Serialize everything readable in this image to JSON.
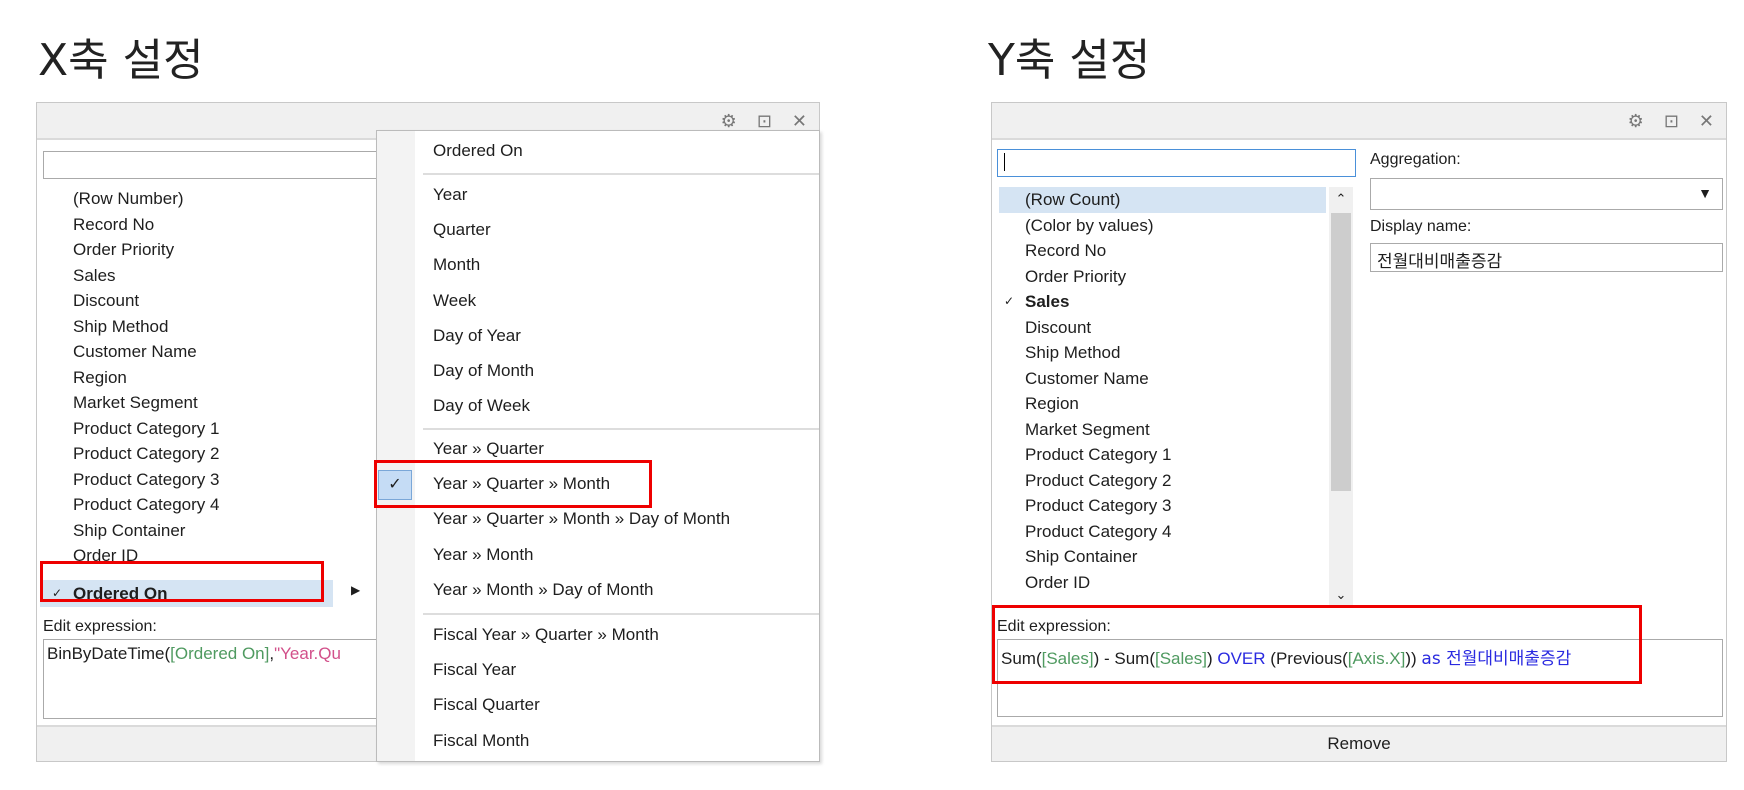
{
  "x_section": {
    "title": "X축 설정",
    "fields": [
      "(Row Number)",
      "Record No",
      "Order Priority",
      "Sales",
      "Discount",
      "Ship Method",
      "Customer Name",
      "Region",
      "Market Segment",
      "Product Category 1",
      "Product Category 2",
      "Product Category 3",
      "Product Category 4",
      "Ship Container",
      "Order ID",
      "Ordered On"
    ],
    "selected_field": "Ordered On",
    "edit_expression_label": "Edit expression:",
    "expression": {
      "fn": "BinByDateTime(",
      "col": "[Ordered On]",
      "sep": ",",
      "str": "\"Year.Qu"
    },
    "menu": {
      "header": "Ordered On",
      "group1": [
        "Year",
        "Quarter",
        "Month",
        "Week",
        "Day of Year",
        "Day of Month",
        "Day of Week"
      ],
      "group2": [
        "Year » Quarter",
        "Year » Quarter » Month",
        "Year » Quarter » Month » Day of Month",
        "Year » Month",
        "Year » Month » Day of Month"
      ],
      "group3": [
        "Fiscal Year » Quarter » Month",
        "Fiscal Year",
        "Fiscal Quarter",
        "Fiscal Month"
      ],
      "checked": "Year » Quarter » Month"
    }
  },
  "y_section": {
    "title": "Y축 설정",
    "search_value": "",
    "fields": [
      "(Row Count)",
      "(Color by values)",
      "Record No",
      "Order Priority",
      "Sales",
      "Discount",
      "Ship Method",
      "Customer Name",
      "Region",
      "Market Segment",
      "Product Category 1",
      "Product Category 2",
      "Product Category 3",
      "Product Category 4",
      "Ship Container",
      "Order ID"
    ],
    "checked_field": "Sales",
    "highlighted_field": "(Row Count)",
    "aggregation_label": "Aggregation:",
    "aggregation_value": "",
    "display_name_label": "Display name:",
    "display_name_value": "전월대비매출증감",
    "edit_expression_label": "Edit expression:",
    "expression": {
      "p1": "Sum(",
      "c1": "[Sales]",
      "p2": ") - Sum(",
      "c2": "[Sales]",
      "p3": ") ",
      "kw1": "OVER",
      "p4": " (Previous(",
      "c3": "[Axis.X]",
      "p5": ")) ",
      "kw2": "as 전월대비매출증감"
    },
    "remove_label": "Remove"
  },
  "colors": {
    "highlight": "#d5e4f3",
    "annotation_red": "#e00000",
    "column_green": "#4f9a60",
    "string_pink": "#d2508a",
    "keyword_blue": "#2a2ae0"
  }
}
